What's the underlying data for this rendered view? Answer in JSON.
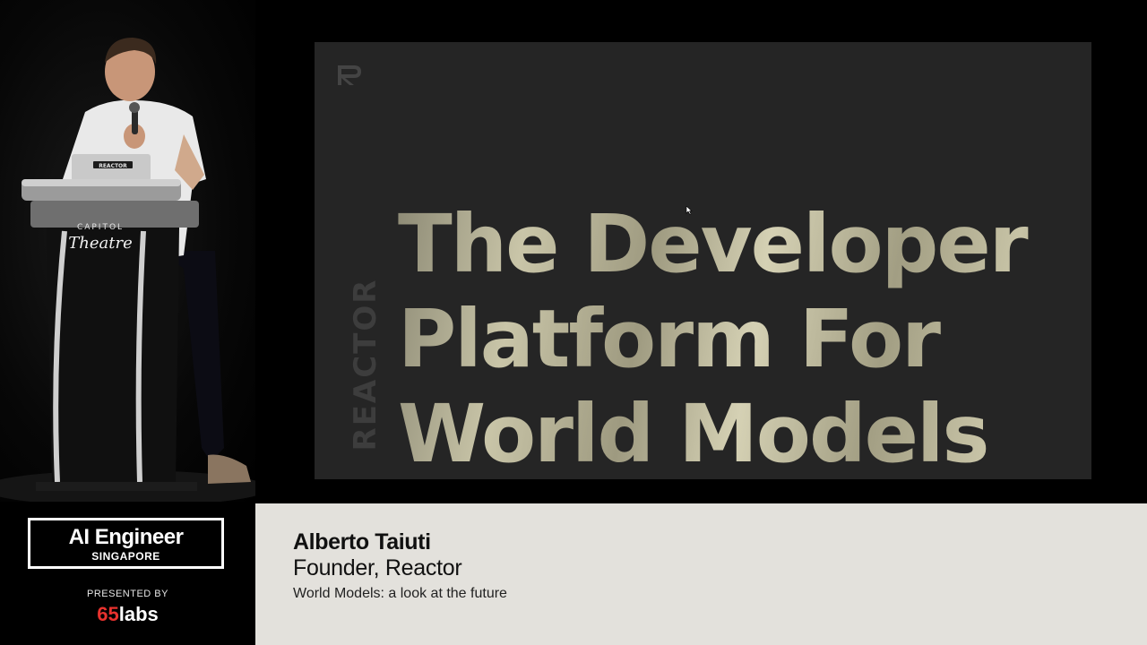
{
  "slide": {
    "headline_line1": "The Developer",
    "headline_line2": "Platform For",
    "headline_line3": "World Models",
    "side_brand": "REACTOR",
    "logo_icon": "reactor-r-logo-icon"
  },
  "podium": {
    "venue_line1": "CAPITOL",
    "venue_line2": "Theatre",
    "laptop_sticker": "REACTOR"
  },
  "event": {
    "name": "AI Engineer",
    "city": "SINGAPORE",
    "presented_by": "PRESENTED BY",
    "sponsor_number": "65",
    "sponsor_word": "labs"
  },
  "speaker": {
    "name": "Alberto Taiuti",
    "role": "Founder, Reactor",
    "talk_title": "World Models: a look at the future"
  },
  "colors": {
    "slide_background": "#252525",
    "headline_gold": "#b9b497",
    "lower_third_background": "#e3e1dc",
    "sponsor_red": "#e8322e"
  }
}
